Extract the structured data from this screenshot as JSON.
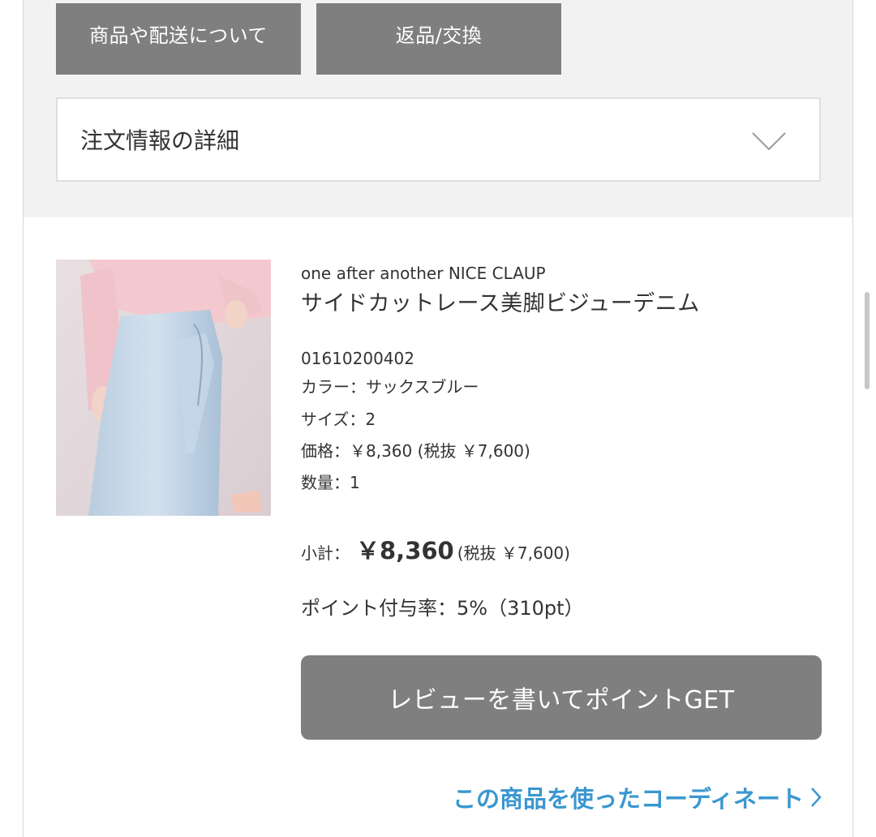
{
  "tabs": {
    "about_label": "商品や配送について",
    "return_label": "返品/交換"
  },
  "accordion": {
    "label": "注文情報の詳細",
    "icon": "chevron-down-icon"
  },
  "product": {
    "brand": "one after another NICE CLAUP",
    "name": "サイドカットレース美脚ビジューデニム",
    "code": "01610200402",
    "color_line": "カラー：サックスブルー",
    "size_line": "サイズ：2",
    "price_line": "価格：￥8,360 (税抜 ￥7,600)",
    "qty_line": "数量：1"
  },
  "subtotal": {
    "label": "小計：",
    "amount": "￥8,360",
    "tax_note": "(税抜 ￥7,600)"
  },
  "points_line": "ポイント付与率：5%（310pt）",
  "review_button": "レビューを書いてポイントGET",
  "coordinate_link": "この商品を使ったコーディネート",
  "colors": {
    "button_gray": "#7f7f7f",
    "panel_gray": "#f2f2f2",
    "link_blue": "#3a97d0"
  }
}
